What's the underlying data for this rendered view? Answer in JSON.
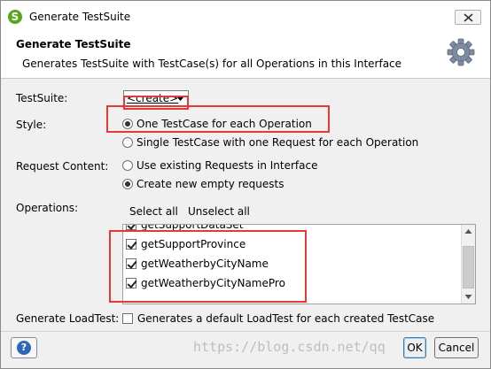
{
  "window": {
    "title": "Generate TestSuite",
    "app_icon": "soapui-icon"
  },
  "header": {
    "title": "Generate TestSuite",
    "description": "Generates TestSuite with TestCase(s) for all Operations in this Interface",
    "icon": "gear-icon"
  },
  "form": {
    "testsuite_label": "TestSuite:",
    "testsuite_value": "<create>",
    "style_label": "Style:",
    "style_options": [
      {
        "label": "One TestCase for each Operation",
        "selected": true
      },
      {
        "label": "Single TestCase with one Request for each Operation",
        "selected": false
      }
    ],
    "request_label": "Request Content:",
    "request_options": [
      {
        "label": "Use existing Requests in Interface",
        "selected": false
      },
      {
        "label": "Create new empty requests",
        "selected": true
      }
    ],
    "operations_label": "Operations:",
    "select_all": "Select all",
    "unselect_all": "Unselect all",
    "operations": [
      {
        "name": "getSupportDataSet",
        "checked": true
      },
      {
        "name": "getSupportProvince",
        "checked": true
      },
      {
        "name": "getWeatherbyCityName",
        "checked": true
      },
      {
        "name": "getWeatherbyCityNamePro",
        "checked": true
      }
    ],
    "loadtest_label": "Generate LoadTest:",
    "loadtest_option": "Generates a default LoadTest for each created TestCase",
    "loadtest_checked": false
  },
  "buttons": {
    "ok": "OK",
    "cancel": "Cancel",
    "help": "?"
  },
  "watermark": "https://blog.csdn.net/qq",
  "colors": {
    "annotation": "#e53935",
    "help_icon": "#2d68b8",
    "app_icon": "#5aa51e"
  }
}
